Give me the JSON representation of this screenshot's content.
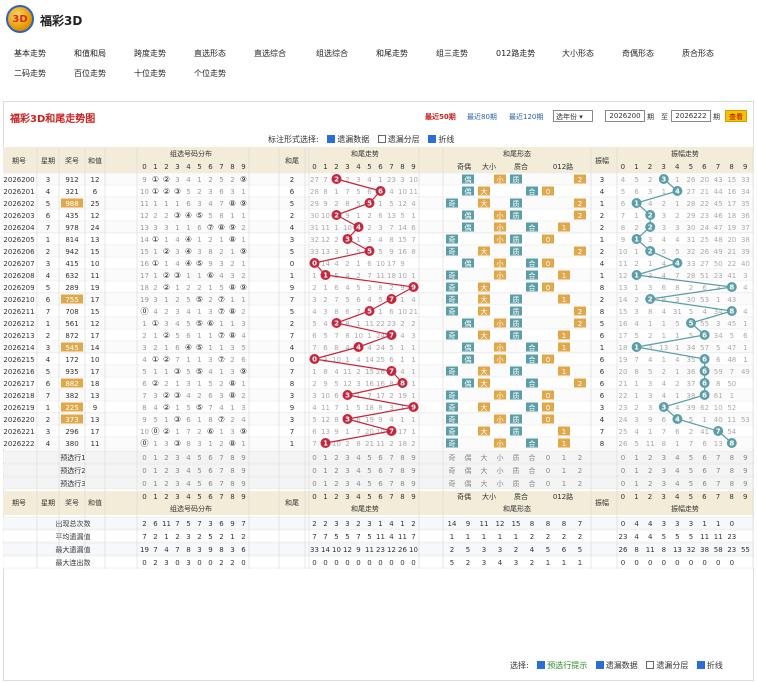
{
  "app": {
    "logo_text": "3D",
    "title": "福彩3D"
  },
  "nav": [
    {
      "label": "基本走势"
    },
    {
      "label": "和值和局"
    },
    {
      "label": "跨度走势"
    },
    {
      "label": "直选形态"
    },
    {
      "label": "直选综合"
    },
    {
      "label": "组选综合"
    },
    {
      "label": "和尾走势"
    },
    {
      "label": "组三走势"
    },
    {
      "label": "012路走势"
    },
    {
      "label": "大小形态"
    },
    {
      "label": "奇偶形态"
    },
    {
      "label": "质合形态"
    },
    {
      "label": "二码走势"
    },
    {
      "label": "百位走势"
    },
    {
      "label": "十位走势"
    },
    {
      "label": "个位走势"
    }
  ],
  "panel": {
    "title": "福彩3D和尾走势图",
    "recent50": "最近50期",
    "recent80": "最近80期",
    "recent120": "最近120期",
    "year_select": "选年份",
    "from": "2026200",
    "period1": "期",
    "to_label": "至",
    "to": "2026222",
    "period2": "期",
    "query": "查看"
  },
  "style_opts": {
    "label": "标注形式选择:",
    "missing": "遗漏数据",
    "layer": "遗漏分层",
    "polyline": "折线"
  },
  "bottom_opts": {
    "label": "选择:",
    "preselect": "预选行提示",
    "missing": "遗漏数据",
    "layer": "遗漏分层",
    "polyline": "折线"
  },
  "header": {
    "period": "期号",
    "weekday": "星期",
    "prize": "奖号",
    "sum": "和值",
    "group": "组选号码分布",
    "tail": "和尾",
    "tail_trend": "和尾走势",
    "shape": "和尾形态",
    "oddeven": "奇偶",
    "size": "大小",
    "prime": "质合",
    "route": "012路",
    "amp": "振幅",
    "amp_trend": "振幅走势"
  },
  "digits": [
    "0",
    "1",
    "2",
    "3",
    "4",
    "5",
    "6",
    "7",
    "8",
    "9"
  ],
  "shape_labels": [
    "奇",
    "偶",
    "大",
    "小",
    "质",
    "合",
    "0",
    "1",
    "2"
  ],
  "colors": {
    "red": "#c4263b",
    "teal": "#5b9ea8",
    "header_bg": "#f3ecd8",
    "accent": "#c22"
  },
  "rows": [
    {
      "period": "2026200",
      "wd": "3",
      "num": "912",
      "sum": "12",
      "grp": [
        "9",
        "①",
        "②",
        "3",
        "4",
        "1",
        "2",
        "5",
        "2",
        "⑨"
      ],
      "tail": "2",
      "tt": [
        "27",
        "7",
        "2",
        "2",
        "3",
        "4",
        "1",
        "23",
        "3",
        "10"
      ],
      "oe": "偶",
      "sz": "小",
      "pc": "质",
      "rt": "2",
      "amp": "3",
      "at": [
        "4",
        "5",
        "2",
        "3",
        "1",
        "26",
        "20",
        "43",
        "15",
        "33"
      ]
    },
    {
      "period": "2026201",
      "wd": "4",
      "num": "321",
      "sum": "6",
      "grp": [
        "10",
        "①",
        "②",
        "③",
        "5",
        "2",
        "3",
        "6",
        "3",
        "1"
      ],
      "tail": "6",
      "tt": [
        "28",
        "8",
        "1",
        "7",
        "5",
        "6",
        "6",
        "4",
        "10",
        "11"
      ],
      "oe": "偶",
      "sz": "大",
      "pc": "合",
      "rt": "0",
      "amp": "4",
      "at": [
        "5",
        "6",
        "3",
        "1",
        "4",
        "27",
        "21",
        "44",
        "16",
        "34"
      ]
    },
    {
      "period": "2026202",
      "wd": "5",
      "num": "988",
      "sum": "25",
      "grp": [
        "11",
        "1",
        "1",
        "1",
        "6",
        "3",
        "4",
        "7",
        "⑧",
        "⑨"
      ],
      "tail": "5",
      "tt": [
        "29",
        "9",
        "2",
        "8",
        "5",
        "5",
        "1",
        "5",
        "12",
        "4"
      ],
      "oe": "奇",
      "sz": "大",
      "pc": "质",
      "rt": "2",
      "amp": "1",
      "at": [
        "6",
        "1",
        "4",
        "2",
        "1",
        "28",
        "22",
        "45",
        "17",
        "35"
      ]
    },
    {
      "period": "2026203",
      "wd": "6",
      "num": "435",
      "sum": "12",
      "grp": [
        "12",
        "2",
        "2",
        "③",
        "④",
        "⑤",
        "5",
        "8",
        "1",
        "1"
      ],
      "tail": "2",
      "tt": [
        "30",
        "10",
        "2",
        "9",
        "1",
        "2",
        "6",
        "13",
        "5",
        "1"
      ],
      "oe": "偶",
      "sz": "小",
      "pc": "质",
      "rt": "2",
      "amp": "2",
      "at": [
        "7",
        "1",
        "2",
        "3",
        "2",
        "29",
        "23",
        "46",
        "18",
        "36"
      ]
    },
    {
      "period": "2026204",
      "wd": "7",
      "num": "978",
      "sum": "24",
      "grp": [
        "13",
        "3",
        "3",
        "1",
        "1",
        "6",
        "⑦",
        "⑧",
        "⑨",
        "2"
      ],
      "tail": "4",
      "tt": [
        "31",
        "11",
        "1",
        "10",
        "4",
        "2",
        "3",
        "7",
        "14",
        "6"
      ],
      "oe": "偶",
      "sz": "小",
      "pc": "合",
      "rt": "1",
      "amp": "2",
      "at": [
        "8",
        "2",
        "2",
        "3",
        "3",
        "30",
        "24",
        "47",
        "19",
        "37"
      ]
    },
    {
      "period": "2026205",
      "wd": "1",
      "num": "814",
      "sum": "13",
      "grp": [
        "14",
        "①",
        "1",
        "4",
        "④",
        "1",
        "2",
        "1",
        "⑧",
        "1"
      ],
      "tail": "3",
      "tt": [
        "32",
        "12",
        "2",
        "3",
        "1",
        "3",
        "4",
        "8",
        "15",
        "7"
      ],
      "oe": "奇",
      "sz": "小",
      "pc": "质",
      "rt": "0",
      "amp": "1",
      "at": [
        "9",
        "1",
        "3",
        "4",
        "4",
        "31",
        "25",
        "48",
        "20",
        "38"
      ]
    },
    {
      "period": "2026206",
      "wd": "2",
      "num": "942",
      "sum": "15",
      "grp": [
        "15",
        "1",
        "②",
        "3",
        "④",
        "3",
        "8",
        "2",
        "1",
        "⑨"
      ],
      "tail": "5",
      "tt": [
        "33",
        "13",
        "3",
        "1",
        "5",
        "5",
        "5",
        "9",
        "16",
        "8"
      ],
      "oe": "奇",
      "sz": "大",
      "pc": "质",
      "rt": "2",
      "amp": "2",
      "at": [
        "10",
        "1",
        "2",
        "5",
        "5",
        "32",
        "26",
        "49",
        "21",
        "39"
      ]
    },
    {
      "period": "2026207",
      "wd": "3",
      "num": "415",
      "sum": "10",
      "grp": [
        "16",
        "①",
        "1",
        "4",
        "④",
        "⑤",
        "9",
        "3",
        "2",
        "1"
      ],
      "tail": "0",
      "tt": [
        "0",
        "14",
        "4",
        "2",
        "1",
        "6",
        "10",
        "17",
        "9"
      ],
      "oe": "偶",
      "sz": "小",
      "pc": "合",
      "rt": "0",
      "amp": "4",
      "at": [
        "11",
        "2",
        "1",
        "4",
        "5",
        "33",
        "27",
        "50",
        "22",
        "40"
      ]
    },
    {
      "period": "2026208",
      "wd": "4",
      "num": "632",
      "sum": "11",
      "grp": [
        "17",
        "1",
        "②",
        "③",
        "1",
        "1",
        "⑥",
        "4",
        "3",
        "2"
      ],
      "tail": "1",
      "tt": [
        "1",
        "1",
        "5",
        "4",
        "2",
        "7",
        "11",
        "18",
        "10",
        "1"
      ],
      "oe": "奇",
      "sz": "小",
      "pc": "合",
      "rt": "1",
      "amp": "1",
      "at": [
        "12",
        "1",
        "3",
        "4",
        "7",
        "28",
        "51",
        "23",
        "41",
        "3"
      ]
    },
    {
      "period": "2026209",
      "wd": "5",
      "num": "289",
      "sum": "19",
      "grp": [
        "18",
        "2",
        "②",
        "1",
        "2",
        "2",
        "1",
        "5",
        "⑧",
        "⑨"
      ],
      "tail": "9",
      "tt": [
        "2",
        "1",
        "6",
        "4",
        "5",
        "3",
        "8",
        "2",
        "9",
        "19"
      ],
      "oe": "奇",
      "sz": "大",
      "pc": "合",
      "rt": "0",
      "amp": "8",
      "at": [
        "13",
        "1",
        "3",
        "6",
        "8",
        "2",
        "6",
        "3",
        "2",
        "4"
      ]
    },
    {
      "period": "2026210",
      "wd": "6",
      "num": "755",
      "sum": "17",
      "grp": [
        "19",
        "3",
        "1",
        "2",
        "5",
        "⑤",
        "2",
        "⑦",
        "1",
        "1"
      ],
      "tail": "7",
      "tt": [
        "3",
        "2",
        "7",
        "5",
        "6",
        "4",
        "5",
        "7",
        "1",
        "4"
      ],
      "oe": "奇",
      "sz": "大",
      "pc": "质",
      "rt": "1",
      "amp": "2",
      "at": [
        "14",
        "2",
        "2",
        "9",
        "3",
        "30",
        "53",
        "1",
        "43"
      ]
    },
    {
      "period": "2026211",
      "wd": "7",
      "num": "708",
      "sum": "15",
      "grp": [
        "⓪",
        "4",
        "2",
        "3",
        "4",
        "1",
        "3",
        "⑦",
        "⑧",
        "2"
      ],
      "tail": "5",
      "tt": [
        "4",
        "3",
        "8",
        "6",
        "7",
        "5",
        "1",
        "6",
        "10",
        "21"
      ],
      "oe": "奇",
      "sz": "大",
      "pc": "质",
      "rt": "2",
      "amp": "8",
      "at": [
        "15",
        "3",
        "8",
        "4",
        "31",
        "5",
        "4",
        "34",
        "3",
        "4"
      ]
    },
    {
      "period": "2026212",
      "wd": "1",
      "num": "561",
      "sum": "12",
      "grp": [
        "1",
        "①",
        "3",
        "4",
        "5",
        "⑤",
        "⑥",
        "1",
        "1",
        "3"
      ],
      "tail": "2",
      "tt": [
        "5",
        "4",
        "2",
        "8",
        "1",
        "11",
        "22",
        "23",
        "2",
        "2"
      ],
      "oe": "偶",
      "sz": "小",
      "pc": "质",
      "rt": "2",
      "amp": "5",
      "at": [
        "16",
        "4",
        "1",
        "1",
        "5",
        "32",
        "55",
        "3",
        "45",
        "1"
      ]
    },
    {
      "period": "2026213",
      "wd": "2",
      "num": "872",
      "sum": "17",
      "grp": [
        "2",
        "1",
        "②",
        "5",
        "6",
        "1",
        "1",
        "⑦",
        "⑧",
        "4"
      ],
      "tail": "7",
      "tt": [
        "6",
        "5",
        "7",
        "8",
        "10",
        "1",
        "24",
        "2",
        "4",
        "3"
      ],
      "oe": "奇",
      "sz": "大",
      "pc": "质",
      "rt": "1",
      "amp": "6",
      "at": [
        "17",
        "5",
        "2",
        "1",
        "1",
        "5",
        "56",
        "34",
        "5",
        "6"
      ]
    },
    {
      "period": "2026214",
      "wd": "3",
      "num": "545",
      "sum": "14",
      "grp": [
        "3",
        "2",
        "1",
        "6",
        "④",
        "⑤",
        "1",
        "1",
        "3",
        "5"
      ],
      "tail": "4",
      "tt": [
        "7",
        "6",
        "8",
        "4",
        "13",
        "4",
        "24",
        "5",
        "1",
        "1"
      ],
      "oe": "偶",
      "sz": "小",
      "pc": "合",
      "rt": "1",
      "amp": "1",
      "at": [
        "18",
        "6",
        "3",
        "13",
        "1",
        "34",
        "57",
        "5",
        "47",
        "1"
      ]
    },
    {
      "period": "2026215",
      "wd": "4",
      "num": "172",
      "sum": "10",
      "grp": [
        "4",
        "①",
        "②",
        "7",
        "1",
        "1",
        "3",
        "⑦",
        "2",
        "6"
      ],
      "tail": "0",
      "tt": [
        "0",
        "3",
        "10",
        "1",
        "4",
        "14",
        "25",
        "6",
        "1",
        "1"
      ],
      "oe": "偶",
      "sz": "小",
      "pc": "合",
      "rt": "0",
      "amp": "6",
      "at": [
        "19",
        "7",
        "4",
        "1",
        "4",
        "35",
        "58",
        "6",
        "48",
        "1"
      ]
    },
    {
      "period": "2026216",
      "wd": "5",
      "num": "935",
      "sum": "17",
      "grp": [
        "5",
        "1",
        "1",
        "③",
        "5",
        "⑤",
        "4",
        "1",
        "3",
        "⑨"
      ],
      "tail": "7",
      "tt": [
        "1",
        "8",
        "4",
        "11",
        "2",
        "15",
        "26",
        "1",
        "4",
        "1"
      ],
      "oe": "奇",
      "sz": "大",
      "pc": "质",
      "rt": "1",
      "amp": "6",
      "at": [
        "20",
        "8",
        "5",
        "2",
        "1",
        "36",
        "6",
        "59",
        "7",
        "49"
      ]
    },
    {
      "period": "2026217",
      "wd": "6",
      "num": "882",
      "sum": "18",
      "grp": [
        "6",
        "②",
        "2",
        "1",
        "3",
        "1",
        "5",
        "2",
        "⑧",
        "1"
      ],
      "tail": "8",
      "tt": [
        "2",
        "9",
        "5",
        "12",
        "3",
        "16",
        "16",
        "8",
        "1",
        "1"
      ],
      "oe": "偶",
      "sz": "大",
      "pc": "合",
      "rt": "2",
      "amp": "6",
      "at": [
        "21",
        "1",
        "3",
        "4",
        "2",
        "37",
        "1",
        "8",
        "50"
      ]
    },
    {
      "period": "2026218",
      "wd": "7",
      "num": "382",
      "sum": "13",
      "grp": [
        "7",
        "3",
        "②",
        "③",
        "4",
        "2",
        "6",
        "3",
        "⑧",
        "2"
      ],
      "tail": "3",
      "tt": [
        "3",
        "10",
        "6",
        "3",
        "1",
        "7",
        "17",
        "2",
        "19",
        "1"
      ],
      "oe": "奇",
      "sz": "小",
      "pc": "质",
      "rt": "0",
      "amp": "6",
      "at": [
        "22",
        "1",
        "3",
        "4",
        "1",
        "38",
        "9",
        "61",
        "1"
      ]
    },
    {
      "period": "2026219",
      "wd": "1",
      "num": "225",
      "sum": "9",
      "grp": [
        "8",
        "4",
        "②",
        "1",
        "5",
        "⑤",
        "7",
        "4",
        "1",
        "3"
      ],
      "tail": "9",
      "tt": [
        "4",
        "11",
        "7",
        "1",
        "5",
        "18",
        "8",
        "3",
        "1",
        "9"
      ],
      "oe": "奇",
      "sz": "大",
      "pc": "合",
      "rt": "0",
      "amp": "3",
      "at": [
        "23",
        "2",
        "3",
        "1",
        "4",
        "39",
        "62",
        "10",
        "52"
      ]
    },
    {
      "period": "2026220",
      "wd": "2",
      "num": "373",
      "sum": "13",
      "grp": [
        "9",
        "5",
        "1",
        "③",
        "6",
        "1",
        "8",
        "⑦",
        "2",
        "4"
      ],
      "tail": "3",
      "tt": [
        "5",
        "12",
        "8",
        "3",
        "6",
        "19",
        "9",
        "4",
        "1",
        "1"
      ],
      "oe": "奇",
      "sz": "小",
      "pc": "质",
      "rt": "0",
      "amp": "4",
      "at": [
        "24",
        "3",
        "9",
        "6",
        "5",
        "5",
        "1",
        "40",
        "11",
        "53"
      ]
    },
    {
      "period": "2026221",
      "wd": "3",
      "num": "296",
      "sum": "17",
      "grp": [
        "10",
        "⓪",
        "②",
        "1",
        "7",
        "2",
        "⑥",
        "1",
        "3",
        "⑨"
      ],
      "tail": "7",
      "tt": [
        "6",
        "13",
        "9",
        "1",
        "7",
        "20",
        "10",
        "1",
        "17",
        "1"
      ],
      "oe": "奇",
      "sz": "大",
      "pc": "质",
      "rt": "1",
      "amp": "7",
      "at": [
        "25",
        "4",
        "1",
        "7",
        "6",
        "2",
        "41",
        "12",
        "54"
      ]
    },
    {
      "period": "2026222",
      "wd": "4",
      "num": "380",
      "sum": "11",
      "grp": [
        "⓪",
        "1",
        "3",
        "③",
        "8",
        "3",
        "1",
        "2",
        "⑧",
        "1"
      ],
      "tail": "1",
      "tt": [
        "7",
        "1",
        "10",
        "2",
        "8",
        "21",
        "11",
        "2",
        "18",
        "2"
      ],
      "oe": "奇",
      "sz": "小",
      "pc": "合",
      "rt": "1",
      "amp": "8",
      "at": [
        "26",
        "5",
        "11",
        "8",
        "1",
        "7",
        "6",
        "13",
        "55"
      ]
    }
  ],
  "preselect": [
    {
      "label": "预选行1"
    },
    {
      "label": "预选行2"
    },
    {
      "label": "预选行3"
    }
  ],
  "stats": [
    {
      "label": "出现总次数",
      "grp": [
        "2",
        "6",
        "11",
        "7",
        "5",
        "7",
        "3",
        "6",
        "9",
        "7"
      ],
      "tail": [
        "2",
        "2",
        "3",
        "3",
        "2",
        "3",
        "1",
        "4",
        "1",
        "2"
      ],
      "shape": [
        "14",
        "9",
        "11",
        "12",
        "15",
        "8",
        "8",
        "8",
        "7"
      ],
      "amp": [
        "0",
        "4",
        "4",
        "3",
        "3",
        "3",
        "1",
        "1",
        "0"
      ]
    },
    {
      "label": "平均遗漏值",
      "grp": [
        "7",
        "2",
        "1",
        "2",
        "3",
        "2",
        "5",
        "2",
        "1",
        "2"
      ],
      "tail": [
        "7",
        "7",
        "5",
        "5",
        "7",
        "5",
        "11",
        "4",
        "11",
        "7"
      ],
      "shape": [
        "1",
        "1",
        "1",
        "1",
        "1",
        "2",
        "2",
        "2",
        "2"
      ],
      "amp": [
        "23",
        "4",
        "4",
        "5",
        "5",
        "5",
        "11",
        "11",
        "23"
      ]
    },
    {
      "label": "最大遗漏值",
      "grp": [
        "19",
        "7",
        "4",
        "7",
        "8",
        "3",
        "9",
        "8",
        "3",
        "6"
      ],
      "tail": [
        "33",
        "14",
        "10",
        "12",
        "9",
        "11",
        "23",
        "12",
        "26",
        "10"
      ],
      "shape": [
        "2",
        "5",
        "3",
        "3",
        "2",
        "4",
        "5",
        "6",
        "5"
      ],
      "amp": [
        "26",
        "8",
        "11",
        "8",
        "13",
        "32",
        "38",
        "58",
        "23",
        "55"
      ]
    },
    {
      "label": "最大连出数",
      "grp": [
        "0",
        "2",
        "3",
        "0",
        "3",
        "0",
        "0",
        "2",
        "2",
        "0"
      ],
      "tail": [
        "0",
        "0",
        "0",
        "0",
        "0",
        "0",
        "0",
        "0",
        "0",
        "0"
      ],
      "shape": [
        "5",
        "2",
        "3",
        "4",
        "3",
        "2",
        "1",
        "1",
        "1"
      ],
      "amp": [
        "0",
        "0",
        "0",
        "0",
        "0",
        "0",
        "0",
        "0",
        "0"
      ]
    }
  ]
}
